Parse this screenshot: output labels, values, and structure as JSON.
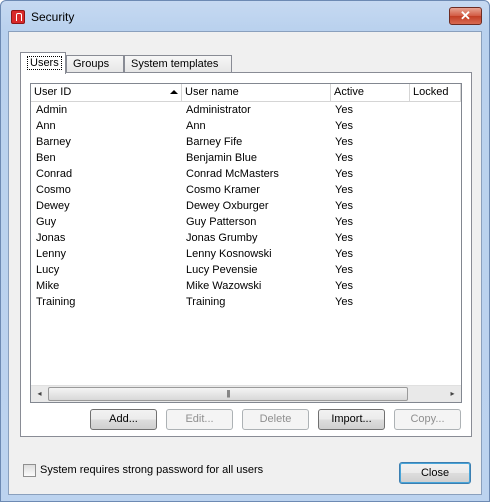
{
  "window": {
    "title": "Security",
    "close_glyph": "✕"
  },
  "tabs": [
    {
      "label": "Users",
      "active": true
    },
    {
      "label": "Groups",
      "active": false
    },
    {
      "label": "System templates",
      "active": false
    }
  ],
  "table": {
    "columns": [
      "User ID",
      "User name",
      "Active",
      "Locked"
    ],
    "sort_column": "User ID",
    "sort_direction": "ascending",
    "rows": [
      [
        "Admin",
        "Administrator",
        "Yes",
        ""
      ],
      [
        "Ann",
        "Ann",
        "Yes",
        ""
      ],
      [
        "Barney",
        "Barney Fife",
        "Yes",
        ""
      ],
      [
        "Ben",
        "Benjamin Blue",
        "Yes",
        ""
      ],
      [
        "Conrad",
        "Conrad McMasters",
        "Yes",
        ""
      ],
      [
        "Cosmo",
        "Cosmo Kramer",
        "Yes",
        ""
      ],
      [
        "Dewey",
        "Dewey Oxburger",
        "Yes",
        ""
      ],
      [
        "Guy",
        "Guy Patterson",
        "Yes",
        ""
      ],
      [
        "Jonas",
        "Jonas Grumby",
        "Yes",
        ""
      ],
      [
        "Lenny",
        "Lenny Kosnowski",
        "Yes",
        ""
      ],
      [
        "Lucy",
        "Lucy Pevensie",
        "Yes",
        ""
      ],
      [
        "Mike",
        "Mike Wazowski",
        "Yes",
        ""
      ],
      [
        "Training",
        "Training",
        "Yes",
        ""
      ]
    ]
  },
  "scroll": {
    "left_glyph": "◂",
    "right_glyph": "▸",
    "grip": "|||"
  },
  "buttons": {
    "add": "Add...",
    "edit": "Edit...",
    "delete": "Delete",
    "import": "Import...",
    "copy": "Copy..."
  },
  "strong_password": {
    "label": "System requires strong password for all users",
    "checked": false
  },
  "close_label": "Close",
  "colors": {
    "title_bar": "#bcd3ef",
    "close_button": "#c23d24",
    "default_border": "#3c7fb1"
  }
}
